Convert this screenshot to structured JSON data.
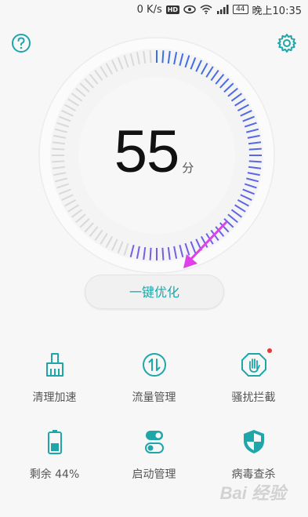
{
  "status_bar": {
    "speed": "0 K/s",
    "hd": "HD",
    "battery": "44",
    "time": "晚上10:35"
  },
  "header": {
    "help_icon": "question-circle-icon",
    "settings_icon": "gear-icon"
  },
  "gauge": {
    "score": "55",
    "unit": "分",
    "score_fraction": 0.55,
    "active_color": "#3b6fe8",
    "active_color_end": "#7b5ce6",
    "inactive_color": "#d9d9d9"
  },
  "optimize_button": {
    "label": "一键优化"
  },
  "accent_color": "#1ea6a9",
  "tools": [
    {
      "label": "清理加速",
      "icon": "broom-icon"
    },
    {
      "label": "流量管理",
      "icon": "data-traffic-icon"
    },
    {
      "label": "骚扰拦截",
      "icon": "hand-block-icon",
      "badge": true
    },
    {
      "label": "剩余 44%",
      "icon": "battery-icon"
    },
    {
      "label": "启动管理",
      "icon": "startup-toggle-icon"
    },
    {
      "label": "病毒查杀",
      "icon": "shield-icon"
    }
  ],
  "watermark": "Bai 经验"
}
